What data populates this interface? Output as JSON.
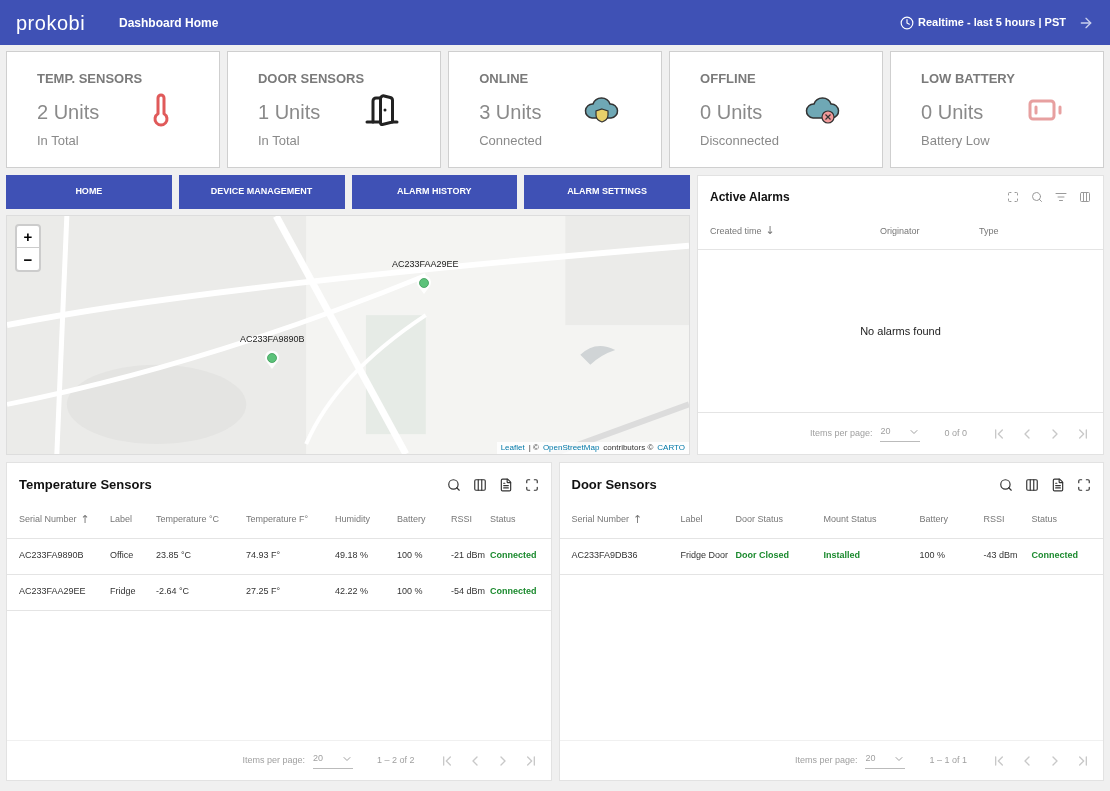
{
  "header": {
    "logo": "prokobi",
    "title": "Dashboard Home",
    "timewindow": "Realtime - last 5 hours | PST"
  },
  "cards": [
    {
      "title": "TEMP. SENSORS",
      "value": "2 Units",
      "caption": "In Total",
      "kind": "thermometer"
    },
    {
      "title": "DOOR SENSORS",
      "value": "1 Units",
      "caption": "In Total",
      "kind": "door"
    },
    {
      "title": "ONLINE",
      "value": "3 Units",
      "caption": "Connected",
      "kind": "cloud-ok"
    },
    {
      "title": "OFFLINE",
      "value": "0 Units",
      "caption": "Disconnected",
      "kind": "cloud-off"
    },
    {
      "title": "LOW BATTERY",
      "value": "0 Units",
      "caption": "Battery Low",
      "kind": "battery"
    }
  ],
  "nav": [
    "HOME",
    "DEVICE MANAGEMENT",
    "ALARM HISTORY",
    "ALARM SETTINGS"
  ],
  "map": {
    "zoom_in": "+",
    "zoom_out": "−",
    "markers": [
      {
        "label": "AC233FAA29EE"
      },
      {
        "label": "AC233FA9890B"
      }
    ],
    "attribution": {
      "leaflet": "Leaflet",
      "separator": "| ©",
      "osm": "OpenStreetMap",
      "contributors": "contributors ©",
      "carto": "CARTO"
    }
  },
  "alarms": {
    "title": "Active Alarms",
    "columns": [
      {
        "label": "Created time",
        "sort_arrow": "↓"
      },
      {
        "label": "Originator"
      },
      {
        "label": "Type"
      }
    ],
    "empty": "No alarms found",
    "pagination": {
      "label": "Items per page:",
      "size": "20",
      "range": "0 of 0"
    }
  },
  "tables": [
    {
      "title": "Temperature Sensors",
      "kind": "temperature",
      "columns": [
        {
          "label": "Serial Number",
          "sort_arrow": "↑"
        },
        {
          "label": "Label"
        },
        {
          "label": "Temperature °C"
        },
        {
          "label": "Temperature F°"
        },
        {
          "label": "Humidity"
        },
        {
          "label": "Battery"
        },
        {
          "label": "RSSI"
        },
        {
          "label": "Status"
        }
      ],
      "rows": [
        {
          "cells": [
            {
              "text": "AC233FA9890B",
              "kind": "text"
            },
            {
              "text": "Office",
              "kind": "text"
            },
            {
              "text": "23.85 °C",
              "kind": "text"
            },
            {
              "text": "74.93 F°",
              "kind": "text"
            },
            {
              "text": "49.18 %",
              "kind": "text"
            },
            {
              "text": "100 %",
              "kind": "text"
            },
            {
              "text": "-21 dBm",
              "kind": "text"
            },
            {
              "text": "Connected",
              "kind": "ok"
            }
          ]
        },
        {
          "cells": [
            {
              "text": "AC233FAA29EE",
              "kind": "text"
            },
            {
              "text": "Fridge",
              "kind": "text"
            },
            {
              "text": "-2.64 °C",
              "kind": "text"
            },
            {
              "text": "27.25 F°",
              "kind": "text"
            },
            {
              "text": "42.22 %",
              "kind": "text"
            },
            {
              "text": "100 %",
              "kind": "text"
            },
            {
              "text": "-54 dBm",
              "kind": "text"
            },
            {
              "text": "Connected",
              "kind": "ok"
            }
          ]
        }
      ],
      "pagination": {
        "label": "Items per page:",
        "size": "20",
        "range": "1 – 2 of 2"
      }
    },
    {
      "title": "Door Sensors",
      "kind": "door",
      "columns": [
        {
          "label": "Serial Number",
          "sort_arrow": "↑"
        },
        {
          "label": "Label"
        },
        {
          "label": "Door Status"
        },
        {
          "label": "Mount Status"
        },
        {
          "label": "Battery"
        },
        {
          "label": "RSSI"
        },
        {
          "label": "Status"
        }
      ],
      "rows": [
        {
          "cells": [
            {
              "text": "AC233FA9DB36",
              "kind": "text"
            },
            {
              "text": "Fridge Door",
              "kind": "text"
            },
            {
              "text": "Door Closed",
              "kind": "ok"
            },
            {
              "text": "Installed",
              "kind": "ok"
            },
            {
              "text": "100 %",
              "kind": "text"
            },
            {
              "text": "-43 dBm",
              "kind": "text"
            },
            {
              "text": "Connected",
              "kind": "ok"
            }
          ]
        }
      ],
      "pagination": {
        "label": "Items per page:",
        "size": "20",
        "range": "1 – 1 of 1"
      }
    }
  ]
}
